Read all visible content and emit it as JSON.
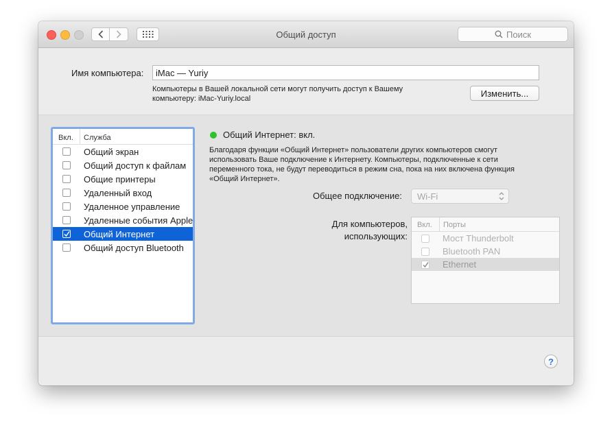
{
  "window": {
    "title": "Общий доступ",
    "search_placeholder": "Поиск"
  },
  "computer_name": {
    "label": "Имя компьютера:",
    "value": "iMac — Yuriy",
    "description_line1": "Компьютеры в Вашей локальной сети могут получить доступ к Вашему",
    "description_line2": "компьютеру: iMac-Yuriy.local",
    "change_button": "Изменить..."
  },
  "services": {
    "header_on": "Вкл.",
    "header_service": "Служба",
    "items": [
      {
        "label": "Общий экран",
        "checked": false,
        "selected": false
      },
      {
        "label": "Общий доступ к файлам",
        "checked": false,
        "selected": false
      },
      {
        "label": "Общие принтеры",
        "checked": false,
        "selected": false
      },
      {
        "label": "Удаленный вход",
        "checked": false,
        "selected": false
      },
      {
        "label": "Удаленное управление",
        "checked": false,
        "selected": false
      },
      {
        "label": "Удаленные события Apple",
        "checked": false,
        "selected": false
      },
      {
        "label": "Общий Интернет",
        "checked": true,
        "selected": true
      },
      {
        "label": "Общий доступ Bluetooth",
        "checked": false,
        "selected": false
      }
    ]
  },
  "detail": {
    "status": "Общий Интернет: вкл.",
    "status_color": "#2ec22c",
    "description_line1": "Благодаря функции «Общий Интернет» пользователи других компьютеров смогут",
    "description_line2": "использовать Ваше подключение к Интернету. Компьютеры, подключенные к сети",
    "description_line3": "переменного тока, не будут переводиться в режим сна, пока на них включена функция",
    "description_line4": "«Общий Интернет».",
    "shared_connection_label": "Общее подключение:",
    "shared_connection_value": "Wi-Fi",
    "for_computers_line1": "Для компьютеров,",
    "for_computers_line2": "использующих:",
    "ports_header_on": "Вкл.",
    "ports_header_name": "Порты",
    "ports": [
      {
        "label": "Мост Thunderbolt",
        "checked": false,
        "selected": false
      },
      {
        "label": "Bluetooth PAN",
        "checked": false,
        "selected": false
      },
      {
        "label": "Ethernet",
        "checked": true,
        "selected": true
      }
    ]
  },
  "help": "?",
  "colors": {
    "selection": "#0f63d8",
    "focus_ring": "#7faae6",
    "close": "#fc605c",
    "minimize": "#fdbc40"
  }
}
